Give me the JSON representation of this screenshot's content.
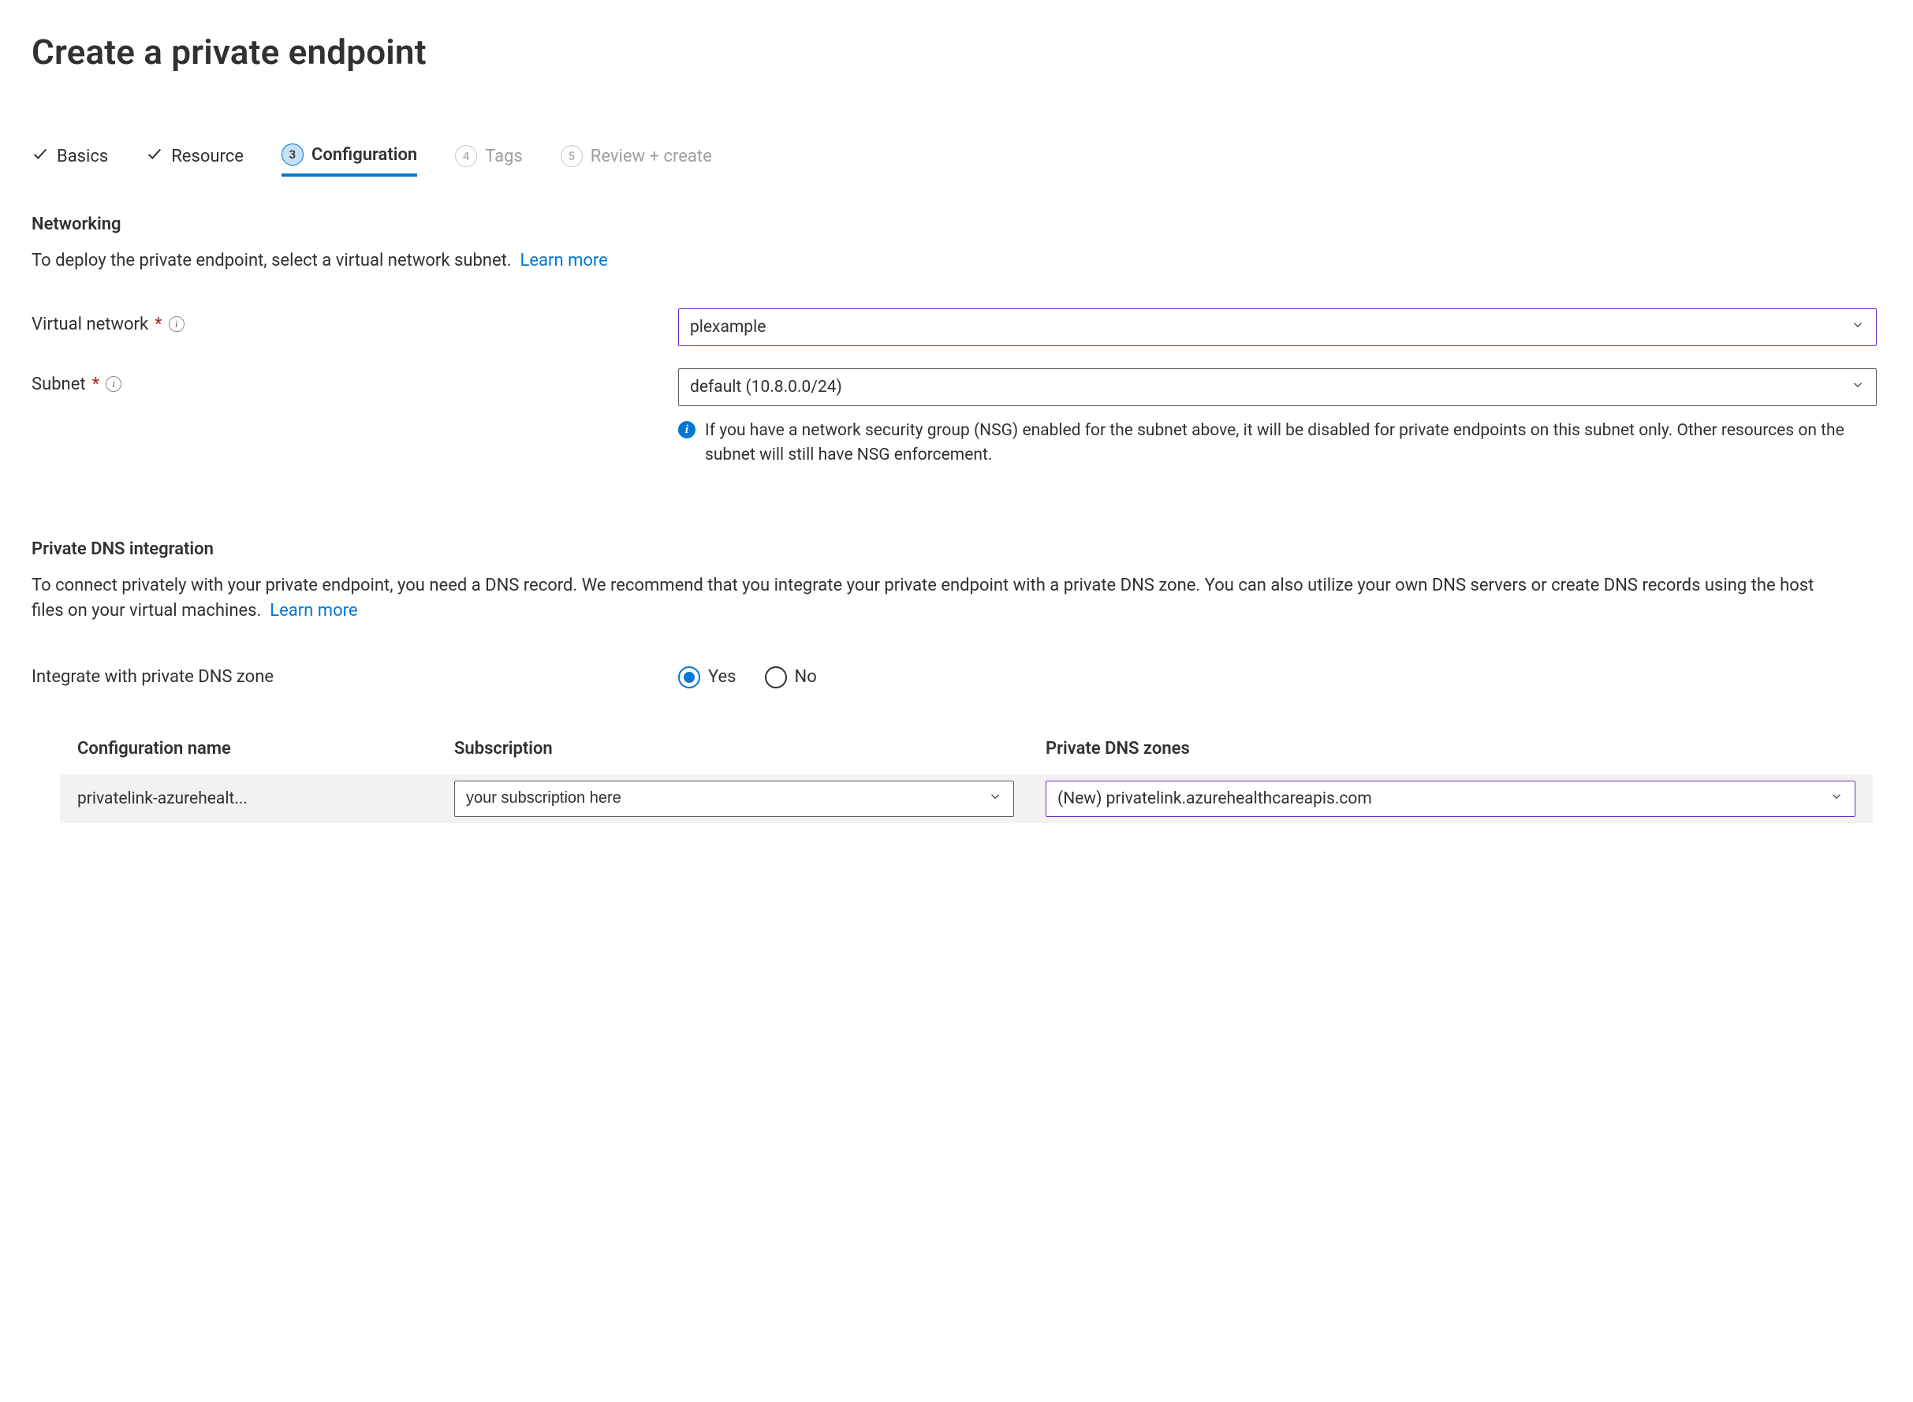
{
  "page_title": "Create a private endpoint",
  "tabs": {
    "basics": "Basics",
    "resource": "Resource",
    "configuration": {
      "num": "3",
      "label": "Configuration"
    },
    "tags": {
      "num": "4",
      "label": "Tags"
    },
    "review": {
      "num": "5",
      "label": "Review + create"
    }
  },
  "networking": {
    "title": "Networking",
    "desc": "To deploy the private endpoint, select a virtual network subnet.",
    "learn_more": "Learn more",
    "vnet_label": "Virtual network",
    "vnet_value": "plexample",
    "subnet_label": "Subnet",
    "subnet_value": "default (10.8.0.0/24)",
    "nsg_note": "If you have a network security group (NSG) enabled for the subnet above, it will be disabled for private endpoints on this subnet only. Other resources on the subnet will still have NSG enforcement."
  },
  "dns": {
    "title": "Private DNS integration",
    "desc": "To connect privately with your private endpoint, you need a DNS record. We recommend that you integrate your private endpoint with a private DNS zone. You can also utilize your own DNS servers or create DNS records using the host files on your virtual machines.",
    "learn_more": "Learn more",
    "integrate_label": "Integrate with private DNS zone",
    "yes": "Yes",
    "no": "No",
    "table": {
      "col_config": "Configuration name",
      "col_sub": "Subscription",
      "col_dns": "Private DNS zones",
      "row": {
        "config_name": "privatelink-azurehealt...",
        "subscription": "your subscription here",
        "dns_zone": "(New) privatelink.azurehealthcareapis.com"
      }
    }
  }
}
